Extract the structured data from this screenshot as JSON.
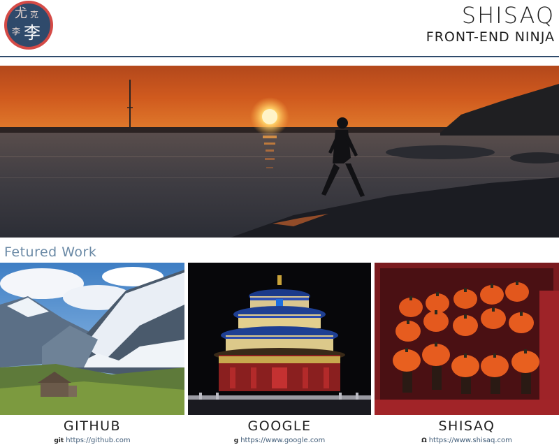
{
  "header": {
    "logo_chars": [
      "尤",
      "克",
      "李",
      "李"
    ],
    "brand_name": "SHISAQ",
    "tagline": "FRONT-END NINJA"
  },
  "featured": {
    "title": "Fetured Work"
  },
  "cards": [
    {
      "title": "GITHUB",
      "icon": "git",
      "icon_name": "github-icon",
      "url": "https://github.com"
    },
    {
      "title": "GOOGLE",
      "icon": "g",
      "icon_name": "google-icon",
      "url": "https://www.google.com"
    },
    {
      "title": "SHISAQ",
      "icon": "Ω",
      "icon_name": "site-icon",
      "url": "https://www.shisaq.com"
    }
  ],
  "colors": {
    "accent": "#2f4a6b",
    "logo_red": "#d44a46",
    "featured_label": "#6b8aa6"
  }
}
